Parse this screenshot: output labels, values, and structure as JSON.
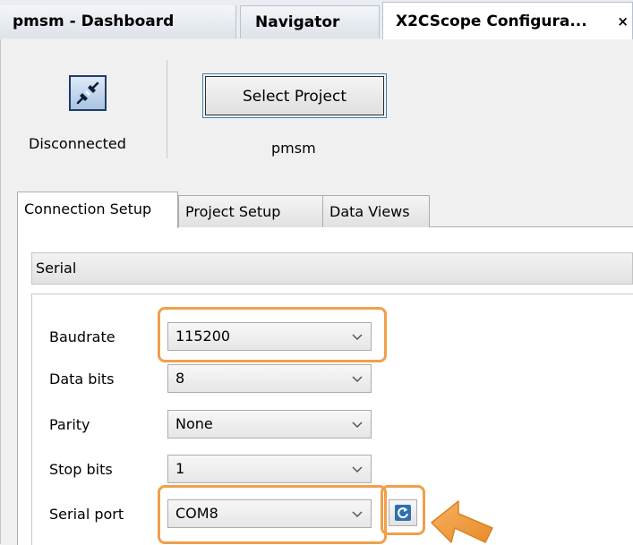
{
  "tabs": [
    {
      "label": "pmsm - Dashboard"
    },
    {
      "label": "Navigator"
    },
    {
      "label": "X2CScope Configura...",
      "close": "×"
    }
  ],
  "connection": {
    "status": "Disconnected",
    "icon": "plug-icon"
  },
  "project": {
    "button_label": "Select Project",
    "name": "pmsm"
  },
  "inner_tabs": [
    {
      "label": "Connection Setup",
      "active": true
    },
    {
      "label": "Project Setup",
      "active": false
    },
    {
      "label": "Data Views",
      "active": false
    }
  ],
  "connection_type": "Serial",
  "fields": {
    "baudrate": {
      "label": "Baudrate",
      "value": "115200"
    },
    "data_bits": {
      "label": "Data bits",
      "value": "8"
    },
    "parity": {
      "label": "Parity",
      "value": "None"
    },
    "stop_bits": {
      "label": "Stop bits",
      "value": "1"
    },
    "serial_port": {
      "label": "Serial port",
      "value": "COM8"
    }
  },
  "colors": {
    "highlight": "#f0a04b",
    "accent": "#1f3b6b"
  }
}
